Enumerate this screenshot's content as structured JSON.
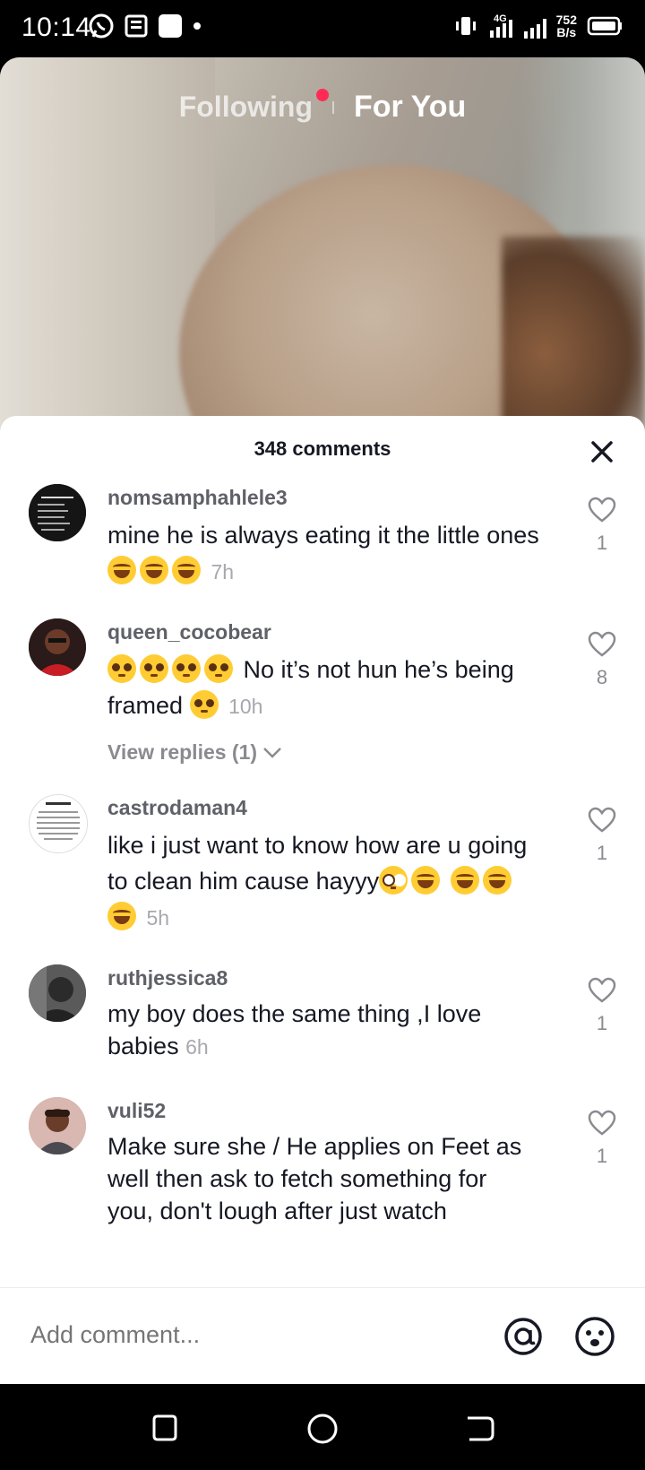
{
  "status_bar": {
    "time": "10:14",
    "network": "4G",
    "speed_value": "752",
    "speed_unit": "B/s"
  },
  "feed_tabs": {
    "following": "Following",
    "for_you": "For You"
  },
  "comments_sheet": {
    "title": "348 comments",
    "comments": [
      {
        "username": "nomsamphahlele3",
        "text": "mine he is always eating it the little ones",
        "emojis": [
          "rofl",
          "joy",
          "rofl"
        ],
        "time": "7h",
        "likes": "1"
      },
      {
        "username": "queen_cocobear",
        "prefix_emojis": [
          "pleading",
          "pleading",
          "pleading",
          "pleading"
        ],
        "text_line1": " No it’s not hun he’s being",
        "text_line2": "framed",
        "emojis": [
          "pleading"
        ],
        "time": "10h",
        "likes": "8",
        "view_replies": "View replies (1)"
      },
      {
        "username": "castrodaman4",
        "text": "like i just want to know how are u going to clean him cause hayyy",
        "emojis": [
          "flushed",
          "joy",
          "joy",
          "joy",
          "joy"
        ],
        "time": "5h",
        "likes": "1"
      },
      {
        "username": "ruthjessica8",
        "text": "my boy does the same thing ,I love babies",
        "time": "6h",
        "likes": "1"
      },
      {
        "username": "vuli52",
        "text": "Make sure she / He applies on Feet as well then ask to fetch something for you, don't lough after just watch",
        "likes": "1"
      }
    ]
  },
  "composer": {
    "placeholder": "Add comment..."
  },
  "colors": {
    "accent": "#fe2c55",
    "text": "#161823",
    "muted": "#8a8b91"
  }
}
